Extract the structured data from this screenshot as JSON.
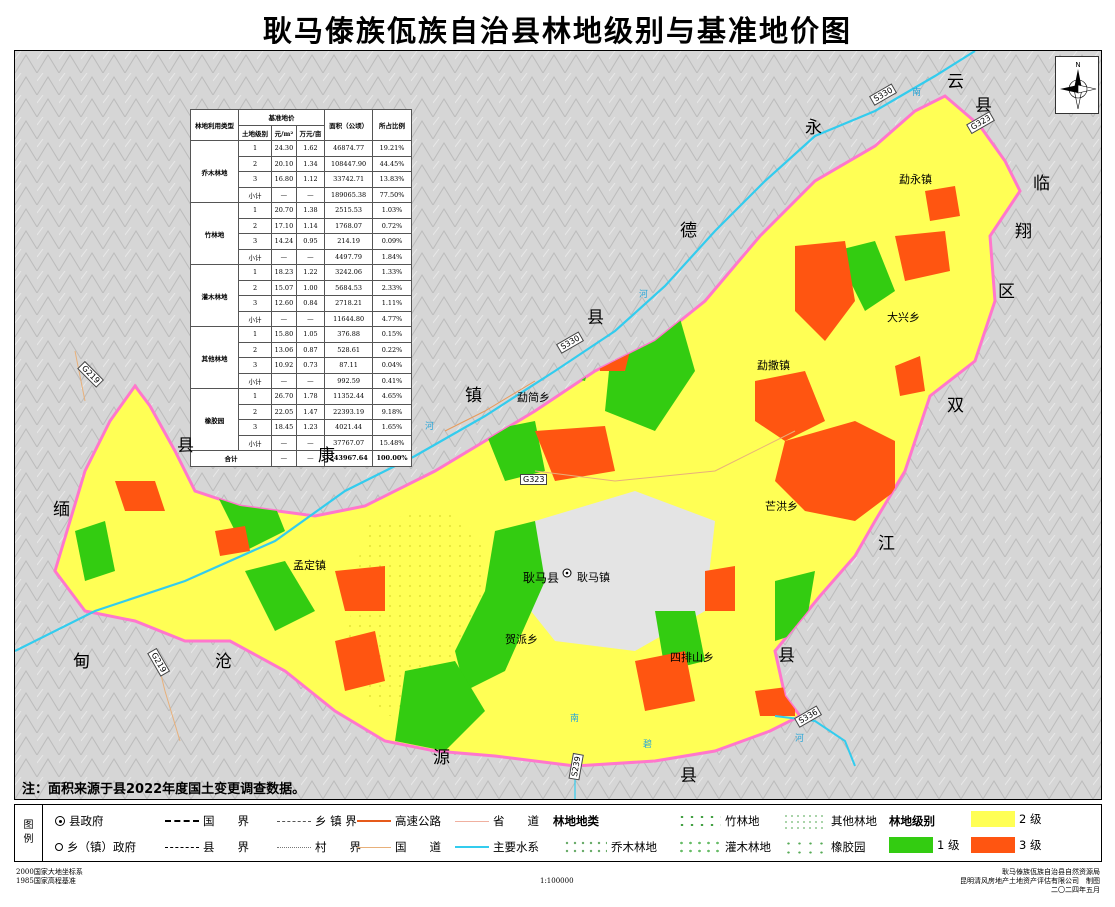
{
  "title": "耿马傣族佤族自治县林地级别与基准地价图",
  "table": {
    "head": {
      "col1": "林地利用类型",
      "group_price": "基准地价",
      "sub_grade": "土地级别",
      "sub_yuan": "元/m²",
      "sub_wan": "万元/亩",
      "col_area": "面积（公顷）",
      "col_ratio": "所占比例"
    },
    "groups": [
      {
        "type": "乔木林地",
        "rows": [
          [
            "1",
            "24.30",
            "1.62",
            "46874.77",
            "19.21%"
          ],
          [
            "2",
            "20.10",
            "1.34",
            "108447.90",
            "44.45%"
          ],
          [
            "3",
            "16.80",
            "1.12",
            "33742.71",
            "13.83%"
          ],
          [
            "小计",
            "—",
            "—",
            "189065.38",
            "77.50%"
          ]
        ]
      },
      {
        "type": "竹林地",
        "rows": [
          [
            "1",
            "20.70",
            "1.38",
            "2515.53",
            "1.03%"
          ],
          [
            "2",
            "17.10",
            "1.14",
            "1768.07",
            "0.72%"
          ],
          [
            "3",
            "14.24",
            "0.95",
            "214.19",
            "0.09%"
          ],
          [
            "小计",
            "—",
            "—",
            "4497.79",
            "1.84%"
          ]
        ]
      },
      {
        "type": "灌木林地",
        "rows": [
          [
            "1",
            "18.23",
            "1.22",
            "3242.06",
            "1.33%"
          ],
          [
            "2",
            "15.07",
            "1.00",
            "5684.53",
            "2.33%"
          ],
          [
            "3",
            "12.60",
            "0.84",
            "2718.21",
            "1.11%"
          ],
          [
            "小计",
            "—",
            "—",
            "11644.80",
            "4.77%"
          ]
        ]
      },
      {
        "type": "其他林地",
        "rows": [
          [
            "1",
            "15.80",
            "1.05",
            "376.88",
            "0.15%"
          ],
          [
            "2",
            "13.06",
            "0.87",
            "528.61",
            "0.22%"
          ],
          [
            "3",
            "10.92",
            "0.73",
            "87.11",
            "0.04%"
          ],
          [
            "小计",
            "—",
            "—",
            "992.59",
            "0.41%"
          ]
        ]
      },
      {
        "type": "橡胶园",
        "rows": [
          [
            "1",
            "26.70",
            "1.78",
            "11352.44",
            "4.65%"
          ],
          [
            "2",
            "22.05",
            "1.47",
            "22393.19",
            "9.18%"
          ],
          [
            "3",
            "18.45",
            "1.23",
            "4021.44",
            "1.65%"
          ],
          [
            "小计",
            "—",
            "—",
            "37767.07",
            "15.48%"
          ]
        ]
      }
    ],
    "total": [
      "合计",
      "—",
      "—",
      "243967.64",
      "100.00%"
    ]
  },
  "compass_letter": "N",
  "labels": {
    "yun": "云",
    "xian1": "县",
    "yong": "永",
    "lin": "临",
    "de": "德",
    "xiang": "翔",
    "qu": "区",
    "xian2": "县",
    "zhen": "镇",
    "shuang": "双",
    "jiang": "江",
    "kang": "康",
    "xian3": "县",
    "mian": "缅",
    "dian": "甸",
    "cang": "沧",
    "yuan": "源",
    "xian4": "县",
    "xian5": "县",
    "mengyong": "勐永镇",
    "daxing": "大兴乡",
    "mengsa": "勐撒镇",
    "mengjian": "勐简乡",
    "manghong": "芒洪乡",
    "mengding": "孟定镇",
    "gengmaxian": "耿马县",
    "gengmazhen": "耿马镇",
    "hepai": "贺派乡",
    "sipaishan": "四排山乡",
    "road_s330a": "S330",
    "road_g323a": "G323",
    "road_s330b": "S330",
    "road_g219a": "G219",
    "road_g323b": "G323",
    "road_g219b": "G219",
    "road_s239": "S239",
    "road_s336": "S336",
    "river_nan1": "南",
    "river_he1": "河",
    "river_he2": "河",
    "river_nan2": "南",
    "river_bi": "碧",
    "river_he3": "河"
  },
  "note": "注：面积来源于县2022年度国土变更调查数据。",
  "legend": {
    "head": [
      "图",
      "例"
    ],
    "county_gov": "县政府",
    "town_gov": "乡（镇）政府",
    "national_border": "国　　界",
    "county_border": "县　　界",
    "town_border": "乡 镇 界",
    "village_border": "村　　界",
    "expressway": "高速公路",
    "national_road": "国　　道",
    "provincial_road": "省　　道",
    "water": "主要水系",
    "forest_class_title": "林地地类",
    "arbor": "乔木林地",
    "bamboo": "竹林地",
    "shrub": "灌木林地",
    "other": "其他林地",
    "rubber": "橡胶园",
    "grade_title": "林地级别",
    "grade1": "1 级",
    "grade2": "2 级",
    "grade3": "3 级"
  },
  "colors": {
    "grade1": "#33cc11",
    "grade2": "#ffff55",
    "grade3": "#ff5511",
    "river": "#33ccee",
    "border": "#ff88cc"
  },
  "footer": {
    "left1": "2000国家大地坐标系",
    "left2": "1985国家高程基准",
    "scale": "1:100000",
    "right1": "耿马傣族佤族自治县自然资源局",
    "right2": "昆明清风房地产土地资产评估有限公司　制图",
    "right3": "二〇二四年五月"
  }
}
